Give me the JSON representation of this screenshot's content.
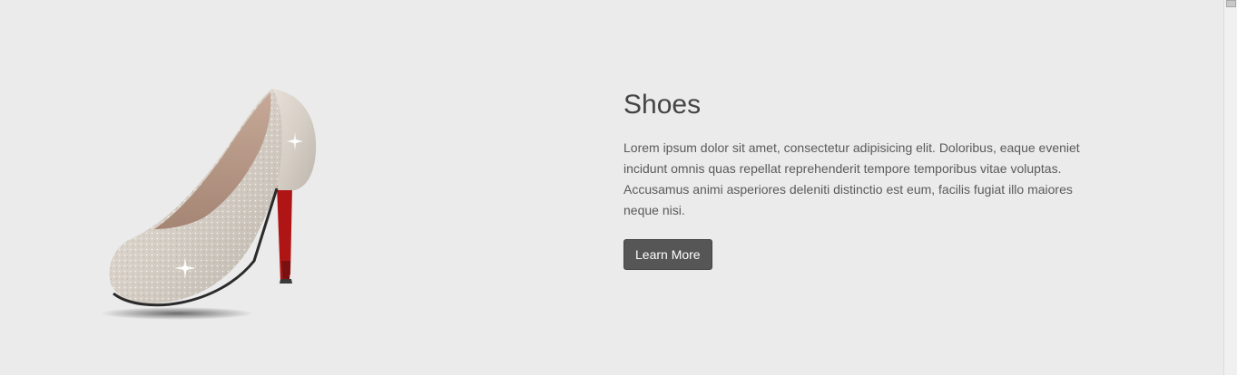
{
  "section": {
    "title": "Shoes",
    "description": "Lorem ipsum dolor sit amet, consectetur adipisicing elit. Doloribus, eaque eveniet incidunt omnis quas repellat reprehenderit tempore temporibus vitae voluptas. Accusamus animi asperiores deleniti distinctio est eum, facilis fugiat illo maiores neque nisi.",
    "button_label": "Learn More"
  },
  "image": {
    "icon": "high-heel-shoe"
  },
  "colors": {
    "background": "#ebebeb",
    "button": "#565656",
    "title": "#444444",
    "text": "#5a5a5a",
    "sole": "#b01515"
  }
}
